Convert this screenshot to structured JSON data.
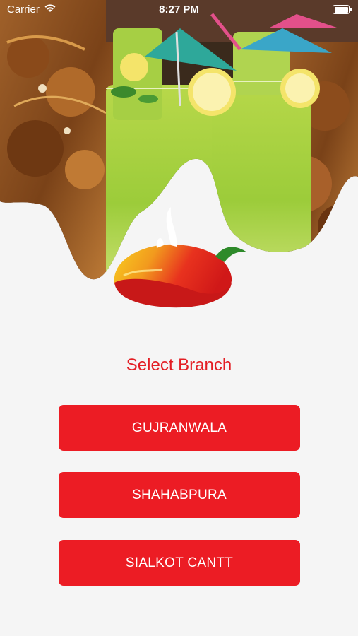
{
  "status_bar": {
    "carrier": "Carrier",
    "time": "8:27 PM",
    "icons": [
      "wifi-icon",
      "battery-icon"
    ]
  },
  "hero": {
    "image": "restaurant food and mint drinks collage",
    "logo": "red and yellow chili pepper logo"
  },
  "main": {
    "title": "Select Branch",
    "branches": [
      {
        "label": "GUJRANWALA"
      },
      {
        "label": "SHAHABPURA"
      },
      {
        "label": "SIALKOT CANTT"
      }
    ]
  },
  "colors": {
    "accent": "#ec1c24",
    "title": "#e31e24",
    "background": "#f5f5f5"
  }
}
